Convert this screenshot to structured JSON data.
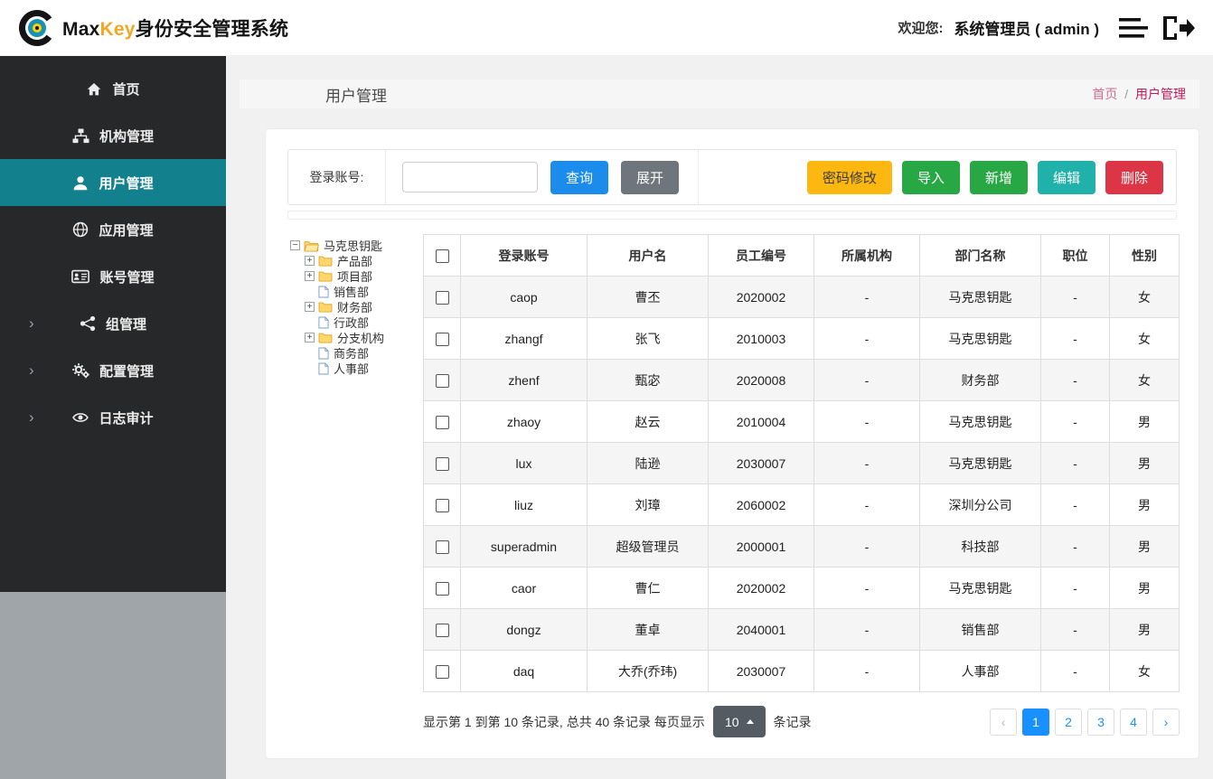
{
  "theme": {
    "accent_teal": "#12808d",
    "primary_blue": "#1b8ceb",
    "success_green": "#28a745",
    "warning_yellow": "#fcb711",
    "danger_red": "#dc3545",
    "edit_teal": "#20b2aa",
    "neutral_gray": "#6e757d",
    "pager_blue": "#1890ff",
    "breadcrumb_pink": "#c2185b",
    "sidebar_dark": "#27282a",
    "brand_yellow": "#f5a623"
  },
  "header": {
    "brand_max": "Max",
    "brand_key": "Key",
    "brand_suffix": "身份安全管理系统",
    "welcome": "欢迎您:",
    "user": "系统管理员 ( admin )"
  },
  "sidebar": {
    "items": [
      {
        "label": "首页",
        "icon": "home",
        "active": false,
        "collapsible": false
      },
      {
        "label": "机构管理",
        "icon": "sitemap",
        "active": false,
        "collapsible": false
      },
      {
        "label": "用户管理",
        "icon": "user",
        "active": true,
        "collapsible": false
      },
      {
        "label": "应用管理",
        "icon": "globe",
        "active": false,
        "collapsible": false
      },
      {
        "label": "账号管理",
        "icon": "idcard",
        "active": false,
        "collapsible": false
      },
      {
        "label": "组管理",
        "icon": "group",
        "active": false,
        "collapsible": true
      },
      {
        "label": "配置管理",
        "icon": "gears",
        "active": false,
        "collapsible": true
      },
      {
        "label": "日志审计",
        "icon": "eye",
        "active": false,
        "collapsible": true
      }
    ]
  },
  "page": {
    "title": "用户管理",
    "breadcrumb": {
      "home": "首页",
      "separator": "/",
      "current": "用户管理"
    }
  },
  "toolbar": {
    "search_label": "登录账号:",
    "search_value": "",
    "buttons": {
      "query": "查询",
      "expand": "展开",
      "password_modify": "密码修改",
      "import": "导入",
      "add": "新增",
      "edit": "编辑",
      "delete": "删除"
    }
  },
  "tree": {
    "nodes": [
      {
        "label": "马克思钥匙",
        "depth": 0,
        "expander": "minus",
        "icon": "folder-open"
      },
      {
        "label": "产品部",
        "depth": 1,
        "expander": "plus",
        "icon": "folder"
      },
      {
        "label": "项目部",
        "depth": 1,
        "expander": "plus",
        "icon": "folder"
      },
      {
        "label": "销售部",
        "depth": 1,
        "expander": "none",
        "icon": "file"
      },
      {
        "label": "财务部",
        "depth": 1,
        "expander": "plus",
        "icon": "folder"
      },
      {
        "label": "行政部",
        "depth": 1,
        "expander": "none",
        "icon": "file"
      },
      {
        "label": "分支机构",
        "depth": 1,
        "expander": "plus",
        "icon": "folder"
      },
      {
        "label": "商务部",
        "depth": 1,
        "expander": "none",
        "icon": "file"
      },
      {
        "label": "人事部",
        "depth": 1,
        "expander": "none",
        "icon": "file"
      }
    ]
  },
  "table": {
    "columns": [
      "登录账号",
      "用户名",
      "员工编号",
      "所属机构",
      "部门名称",
      "职位",
      "性别"
    ],
    "rows": [
      [
        "caop",
        "曹丕",
        "2020002",
        "-",
        "马克思钥匙",
        "-",
        "女"
      ],
      [
        "zhangf",
        "张飞",
        "2010003",
        "-",
        "马克思钥匙",
        "-",
        "女"
      ],
      [
        "zhenf",
        "甄宓",
        "2020008",
        "-",
        "财务部",
        "-",
        "女"
      ],
      [
        "zhaoy",
        "赵云",
        "2010004",
        "-",
        "马克思钥匙",
        "-",
        "男"
      ],
      [
        "lux",
        "陆逊",
        "2030007",
        "-",
        "马克思钥匙",
        "-",
        "男"
      ],
      [
        "liuz",
        "刘璋",
        "2060002",
        "-",
        "深圳分公司",
        "-",
        "男"
      ],
      [
        "superadmin",
        "超级管理员",
        "2000001",
        "-",
        "科技部",
        "-",
        "男"
      ],
      [
        "caor",
        "曹仁",
        "2020002",
        "-",
        "马克思钥匙",
        "-",
        "男"
      ],
      [
        "dongz",
        "董卓",
        "2040001",
        "-",
        "销售部",
        "-",
        "男"
      ],
      [
        "daq",
        "大乔(乔玮)",
        "2030007",
        "-",
        "人事部",
        "-",
        "女"
      ]
    ]
  },
  "pagination": {
    "summary_prefix": "显示第 1 到第 10 条记录, 总共 40 条记录 每页显示",
    "page_size": "10",
    "summary_suffix": "条记录",
    "prev": "‹",
    "next": "›",
    "pages": [
      "1",
      "2",
      "3",
      "4"
    ],
    "active_page": "1"
  }
}
